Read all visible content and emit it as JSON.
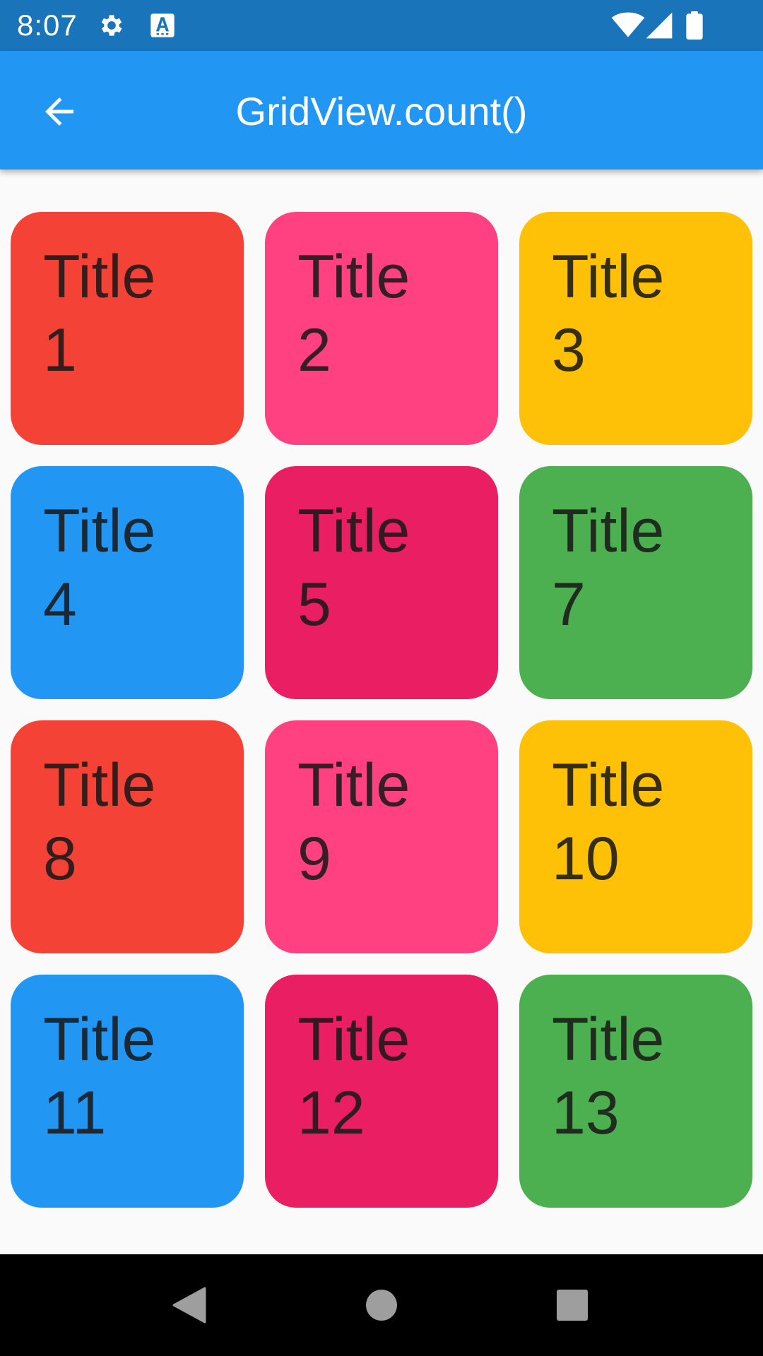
{
  "status_bar": {
    "time": "8:07",
    "icons": [
      "gear-icon",
      "keyboard-a-icon",
      "wifi-icon",
      "signal-icon",
      "battery-icon"
    ]
  },
  "app_bar": {
    "title": "GridView.count()",
    "back_icon": "arrow-back-icon"
  },
  "colors": {
    "status_bar": "#1A74BA",
    "app_bar": "#2196F3",
    "background": "#FAFAFA",
    "red": "#F44336",
    "pink": "#FF4081",
    "amber": "#FFC107",
    "blue": "#2196F3",
    "magenta": "#E91E63",
    "green": "#4CAF50"
  },
  "grid": {
    "items": [
      {
        "label": "Title\n1",
        "color": "#F44336"
      },
      {
        "label": "Title\n2",
        "color": "#FF4081"
      },
      {
        "label": "Title\n3",
        "color": "#FFC107"
      },
      {
        "label": "Title\n4",
        "color": "#2196F3"
      },
      {
        "label": "Title\n5",
        "color": "#E91E63"
      },
      {
        "label": "Title\n7",
        "color": "#4CAF50"
      },
      {
        "label": "Title\n8",
        "color": "#F44336"
      },
      {
        "label": "Title\n9",
        "color": "#FF4081"
      },
      {
        "label": "Title\n10",
        "color": "#FFC107"
      },
      {
        "label": "Title\n11",
        "color": "#2196F3"
      },
      {
        "label": "Title\n12",
        "color": "#E91E63"
      },
      {
        "label": "Title\n13",
        "color": "#4CAF50"
      }
    ]
  },
  "nav_bar": {
    "buttons": [
      "nav-back-icon",
      "nav-home-icon",
      "nav-recents-icon"
    ]
  }
}
